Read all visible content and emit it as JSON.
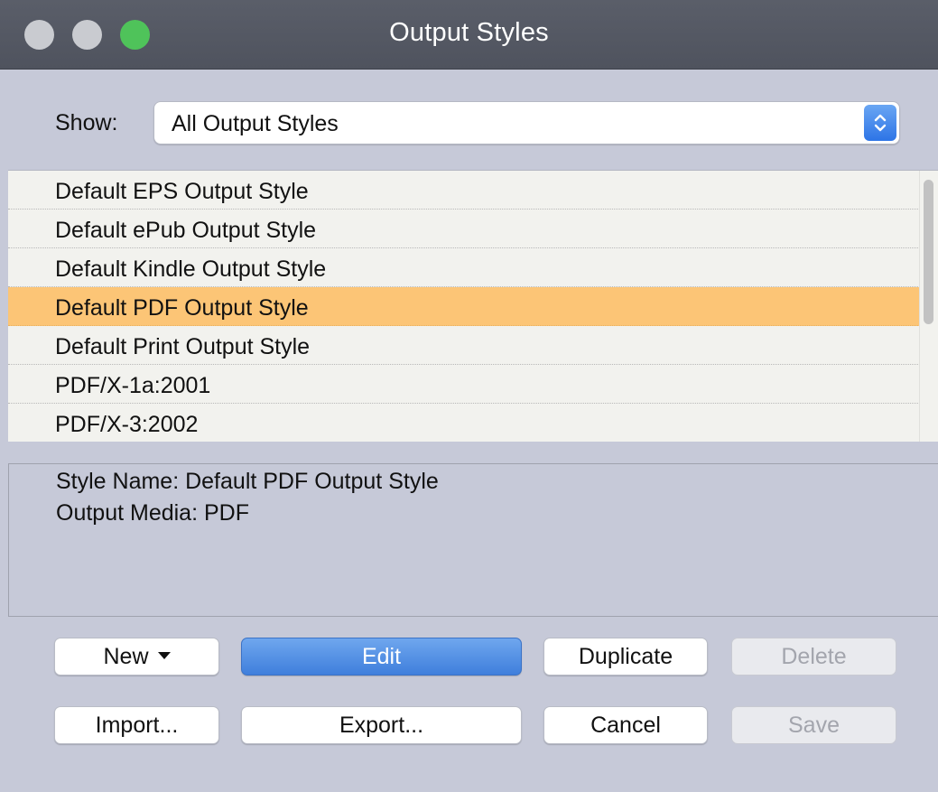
{
  "window": {
    "title": "Output Styles"
  },
  "show": {
    "label": "Show:",
    "selected": "All Output Styles"
  },
  "list": {
    "items": [
      {
        "label": "Default EPS Output Style",
        "selected": false
      },
      {
        "label": "Default ePub Output Style",
        "selected": false
      },
      {
        "label": "Default Kindle Output Style",
        "selected": false
      },
      {
        "label": "Default PDF Output Style",
        "selected": true
      },
      {
        "label": "Default Print Output Style",
        "selected": false
      },
      {
        "label": "PDF/X-1a:2001",
        "selected": false
      },
      {
        "label": "PDF/X-3:2002",
        "selected": false
      }
    ]
  },
  "info": {
    "style_name": "Style Name: Default PDF Output Style",
    "output_media": "Output Media: PDF"
  },
  "buttons": {
    "new": "New",
    "edit": "Edit",
    "duplicate": "Duplicate",
    "delete": "Delete",
    "import": "Import...",
    "export": "Export...",
    "cancel": "Cancel",
    "save": "Save"
  },
  "colors": {
    "selection": "#fcc576",
    "accent": "#3f7fdc",
    "zoom_button": "#4fc35a"
  },
  "icons": {
    "new_dropdown": "dropdown-triangle-icon",
    "select_stepper": "up-down-chevron-icon"
  }
}
